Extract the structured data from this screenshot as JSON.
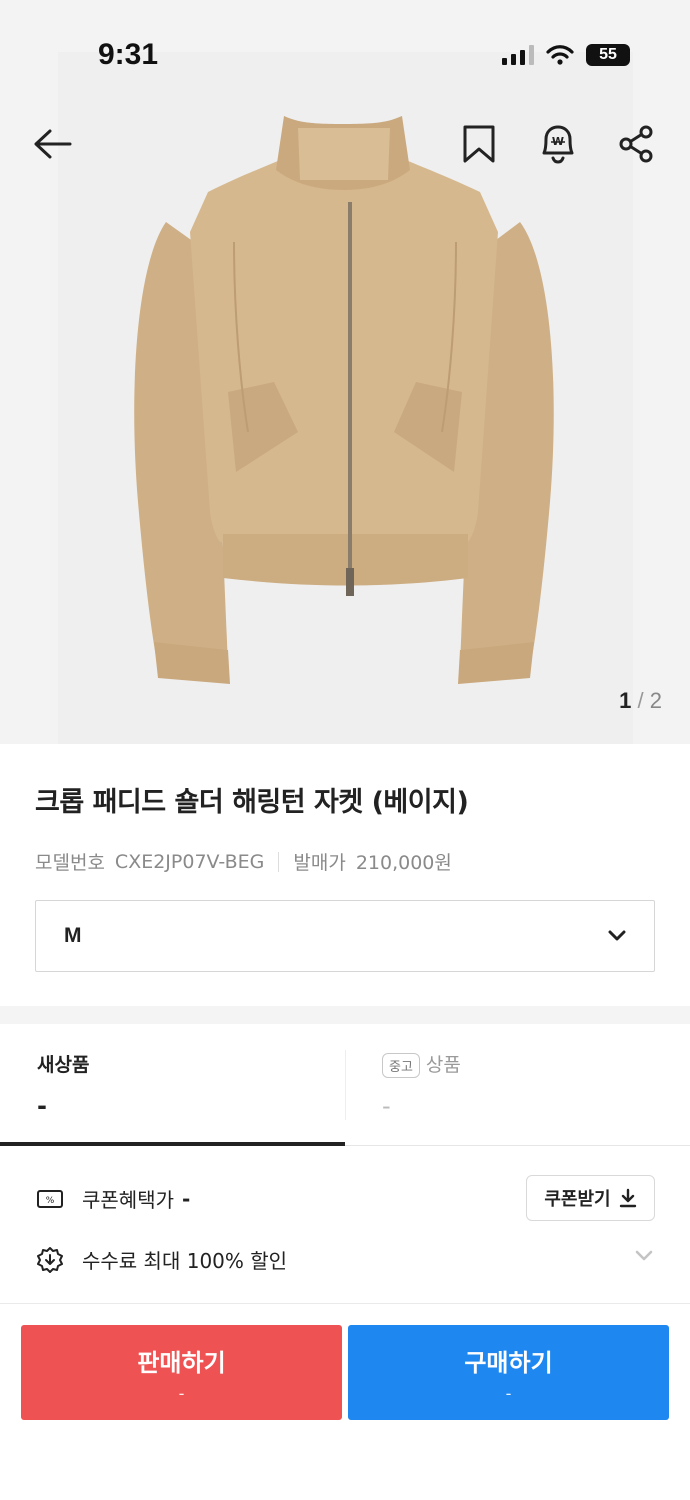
{
  "status_bar": {
    "time": "9:31",
    "battery": "55"
  },
  "icons": {
    "back": "arrow-left-icon",
    "bookmark": "bookmark-icon",
    "price_alert": "won-bell-icon",
    "share": "share-icon",
    "chevron": "chevron-down-icon",
    "coupon": "coupon-icon",
    "download": "download-icon",
    "discount": "discount-badge-icon"
  },
  "gallery": {
    "current": "1",
    "separator": "/",
    "total": "2"
  },
  "product": {
    "title": "크롭 패디드 숄더 해링턴 자켓 (베이지)",
    "model_label": "모델번호",
    "model_number": "CXE2JP07V-BEG",
    "release_label": "발매가",
    "release_price": "210,000원"
  },
  "size_select": {
    "value": "M"
  },
  "tabs": {
    "new": {
      "label": "새상품",
      "price": "-"
    },
    "used": {
      "badge": "중고",
      "label": "상품",
      "price": "-"
    }
  },
  "coupon": {
    "label": "쿠폰혜택가",
    "price": "-",
    "button_label": "쿠폰받기"
  },
  "fee": {
    "text": "수수료 최대 100% 할인"
  },
  "actions": {
    "sell": {
      "label": "판매하기",
      "price": "-"
    },
    "buy": {
      "label": "구매하기",
      "price": "-"
    }
  },
  "colors": {
    "sell": "#ef5252",
    "buy": "#1e88f0",
    "jacket": "#d6b88e"
  }
}
